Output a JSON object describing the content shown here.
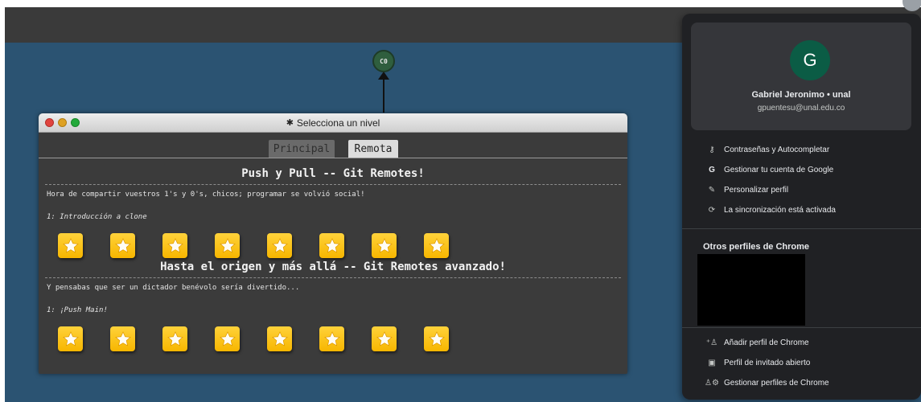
{
  "graph": {
    "commit_label": "C0"
  },
  "level_window": {
    "title": "Selecciona un nivel",
    "tabs": [
      {
        "label": "Principal"
      },
      {
        "label": "Remota"
      }
    ],
    "sections": [
      {
        "title": "Push y Pull -- Git Remotes!",
        "description": "Hora de compartir vuestros 1's y 0's, chicos; programar se volvió social!",
        "sublevel": "1: Introducción a clone",
        "stars": 8
      },
      {
        "title": "Hasta el origen y más allá -- Git Remotes avanzado!",
        "description": "Y pensabas que ser un dictador benévolo sería divertido...",
        "sublevel": "1: ¡Push Main!",
        "stars": 8
      }
    ]
  },
  "profile_panel": {
    "avatar_letter": "G",
    "name": "Gabriel Jeronimo • unal",
    "email": "gpuentesu@unal.edu.co",
    "menu": [
      {
        "label": "Contraseñas y Autocompletar",
        "icon": "key-icon"
      },
      {
        "label": "Gestionar tu cuenta de Google",
        "icon": "google-g-icon"
      },
      {
        "label": "Personalizar perfil",
        "icon": "pencil-icon"
      },
      {
        "label": "La sincronización está activada",
        "icon": "sync-icon"
      }
    ],
    "other_profiles_title": "Otros perfiles de Chrome",
    "footer": [
      {
        "label": "Añadir perfil de Chrome",
        "icon": "add-person-icon"
      },
      {
        "label": "Perfil de invitado abierto",
        "icon": "guest-profile-icon"
      },
      {
        "label": "Gestionar perfiles de Chrome",
        "icon": "manage-profiles-icon"
      }
    ]
  },
  "colors": {
    "canvas_background": "#2b5372",
    "star_button": "#f7b600",
    "avatar": "#0b5c45",
    "panel_background": "#202124"
  }
}
